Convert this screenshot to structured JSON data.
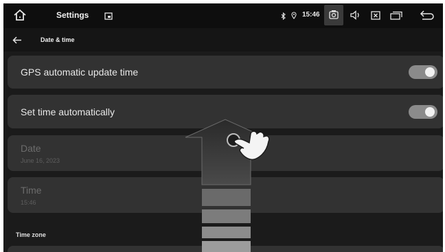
{
  "statusbar": {
    "title": "Settings",
    "clock": "15:46",
    "icons": [
      "home-icon",
      "window-icon",
      "bluetooth-icon",
      "location-icon",
      "camera-icon",
      "volume-icon",
      "close-box-icon",
      "recents-icon",
      "back-return-icon"
    ]
  },
  "subheader": {
    "title": "Date & time",
    "back_icon": "arrow-left-icon"
  },
  "settings": {
    "gps_label": "GPS automatic update time",
    "gps_on": true,
    "auto_label": "Set time automatically",
    "auto_on": true,
    "date_label": "Date",
    "date_value": "June 16, 2023",
    "time_label": "Time",
    "time_value": "15:46"
  },
  "section": {
    "timezone_header": "Time zone"
  },
  "overlay": {
    "icons": [
      "scroll-up-arrow-icon",
      "hand-tap-icon"
    ]
  },
  "colors": {
    "background": "#1b1b1b",
    "row": "#323232",
    "toggle_track": "#8b8b8b",
    "toggle_knob": "#f2f2f2",
    "text": "#e8e8e8",
    "disabled_text": "#6c6c6c"
  }
}
